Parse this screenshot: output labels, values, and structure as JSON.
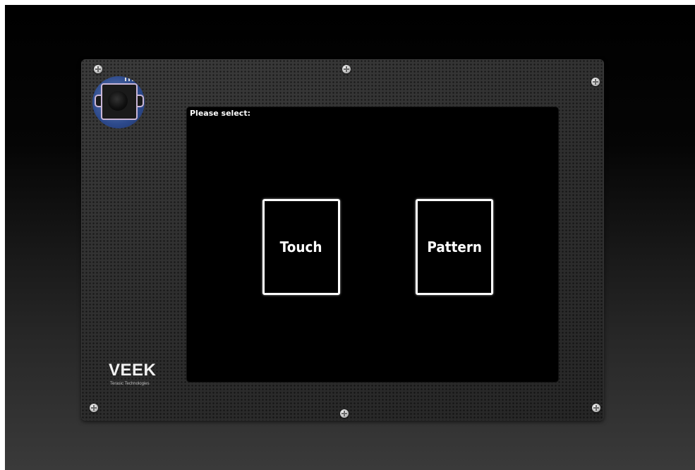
{
  "device": {
    "brand": "VEEK",
    "brand_subtitle": "Terasic Technologies"
  },
  "screen": {
    "prompt": "Please select:",
    "options": [
      {
        "label": "Touch"
      },
      {
        "label": "Pattern"
      }
    ]
  },
  "icons": [
    "camera-icon",
    "screw-icon"
  ],
  "colors": {
    "screen_background": "#000000",
    "option_border": "#ffffff",
    "option_text": "#ffffff",
    "panel": "#303030"
  }
}
